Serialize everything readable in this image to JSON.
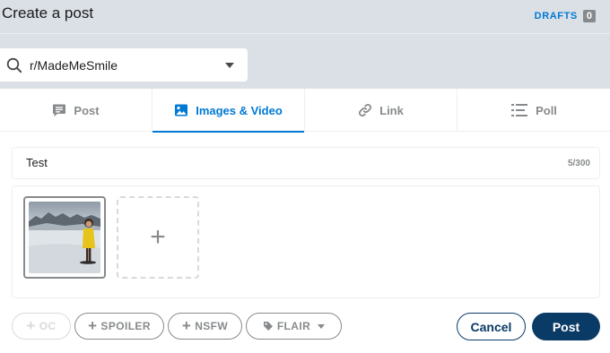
{
  "header": {
    "title": "Create a post",
    "drafts_label": "DRAFTS",
    "drafts_count": "0"
  },
  "community": {
    "name": "r/MadeMeSmile"
  },
  "tabs": [
    {
      "label": "Post",
      "icon": "post-icon"
    },
    {
      "label": "Images & Video",
      "icon": "image-icon",
      "active": true
    },
    {
      "label": "Link",
      "icon": "link-icon"
    },
    {
      "label": "Poll",
      "icon": "poll-icon"
    }
  ],
  "post": {
    "title_value": "Test",
    "char_count": "5/300"
  },
  "media": {
    "add_glyph": "+"
  },
  "tags": {
    "oc": "OC",
    "spoiler": "SPOILER",
    "nsfw": "NSFW",
    "flair": "FLAIR",
    "plus": "+"
  },
  "actions": {
    "cancel": "Cancel",
    "post": "Post"
  },
  "colors": {
    "accent": "#0079d3",
    "primary_button": "#0a3a66",
    "background": "#dae0e6"
  }
}
